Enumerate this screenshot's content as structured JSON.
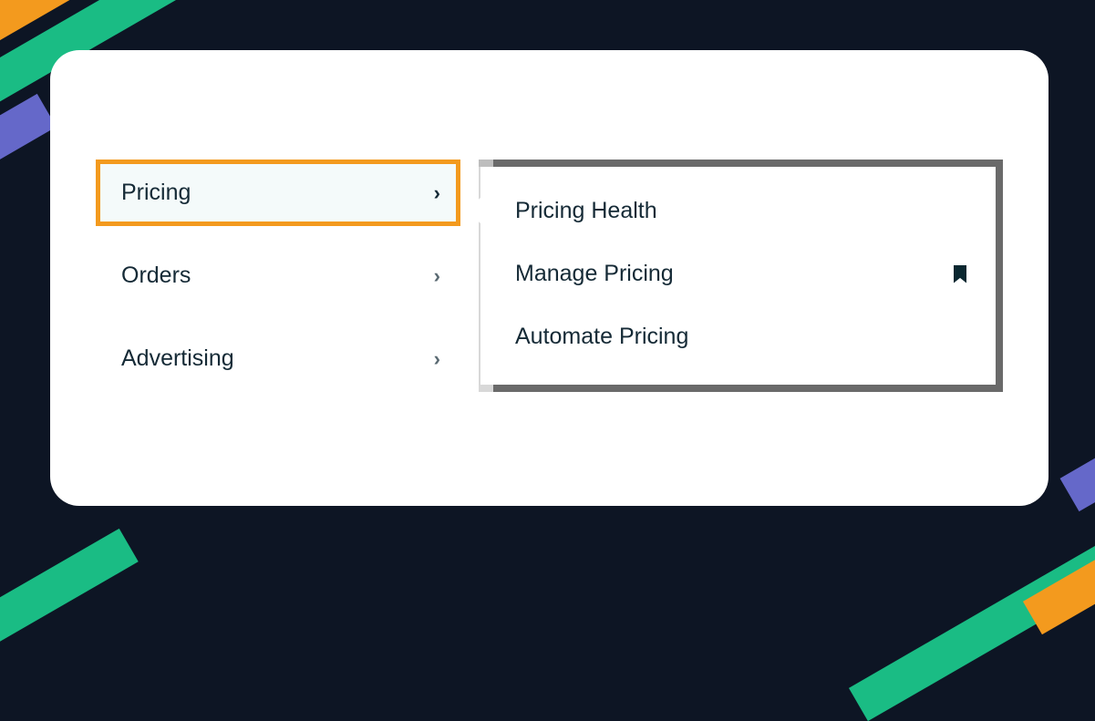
{
  "nav": {
    "items": [
      {
        "label": "Pricing",
        "active": true
      },
      {
        "label": "Orders",
        "active": false
      },
      {
        "label": "Advertising",
        "active": false
      }
    ]
  },
  "submenu": {
    "items": [
      {
        "label": "Pricing Health",
        "bookmarked": false
      },
      {
        "label": "Manage Pricing",
        "bookmarked": true
      },
      {
        "label": "Automate Pricing",
        "bookmarked": false
      }
    ]
  }
}
